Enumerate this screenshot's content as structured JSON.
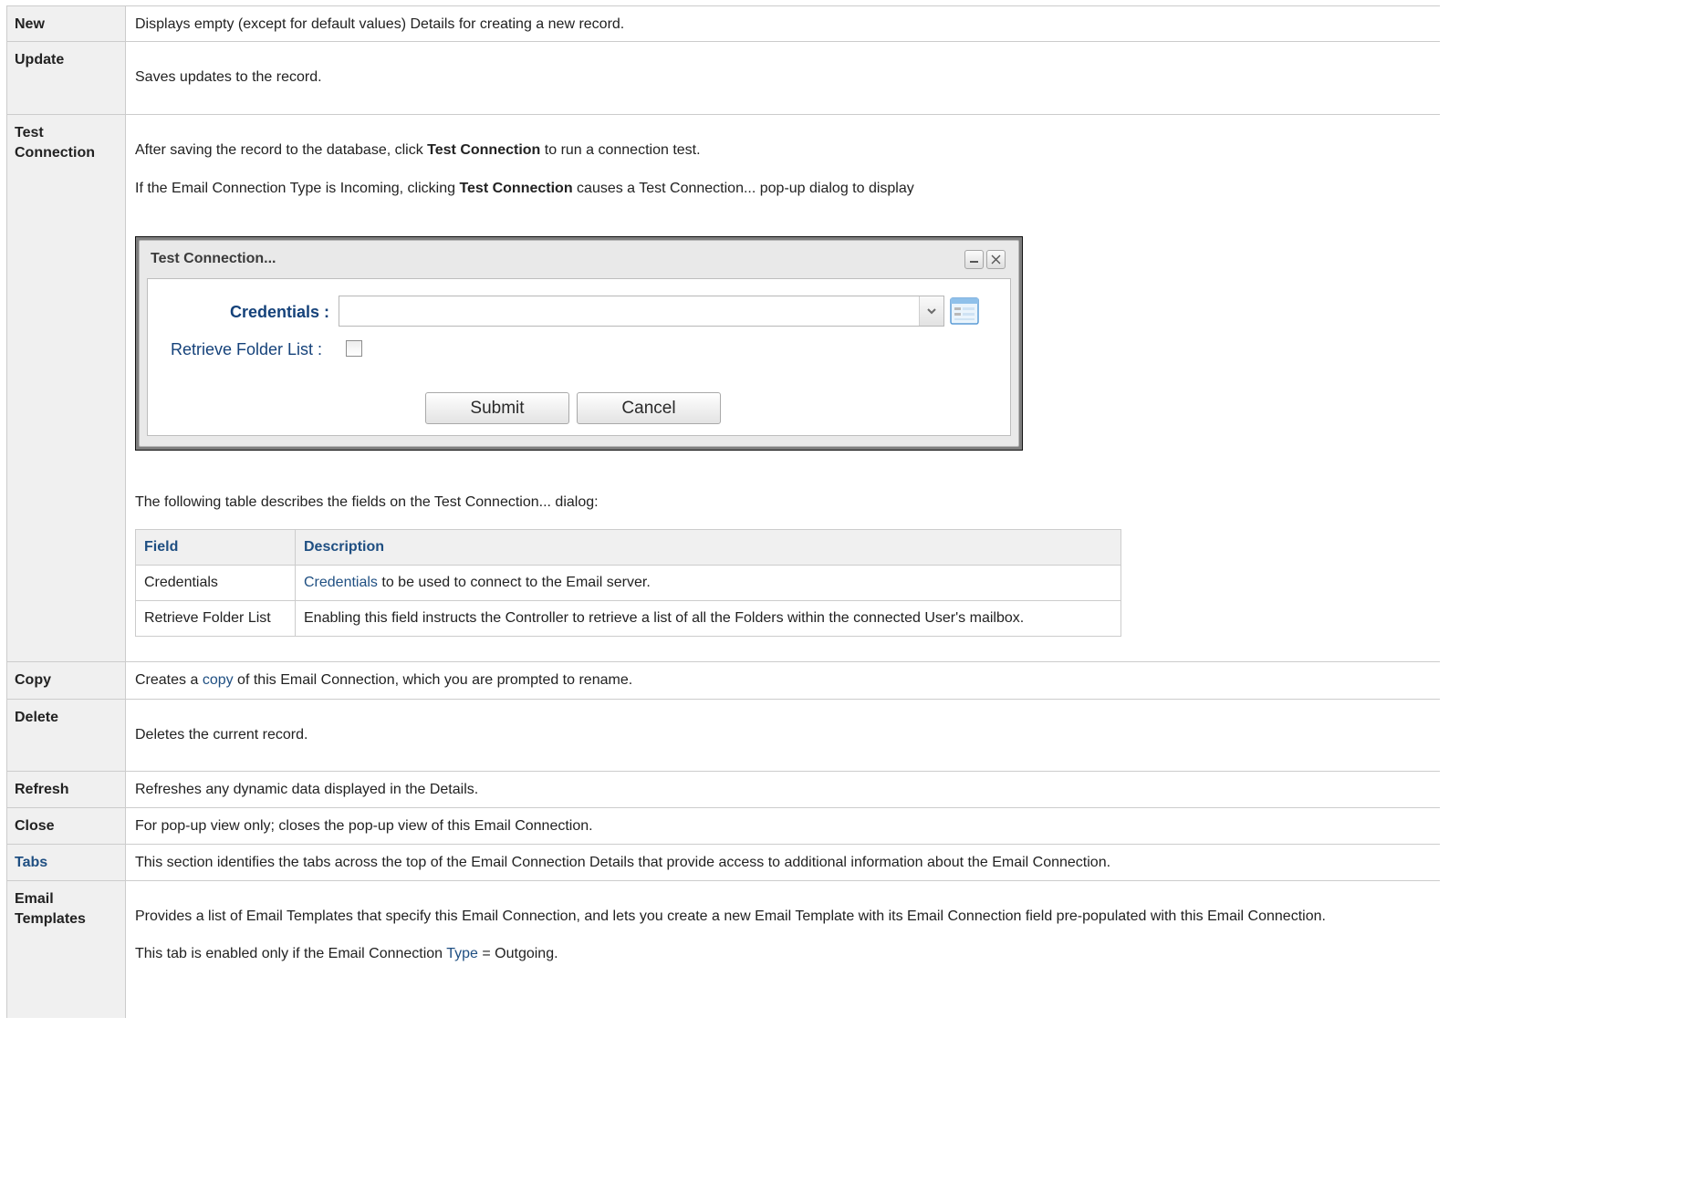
{
  "rows": {
    "new": {
      "label": "New",
      "desc": "Displays empty (except for default values) Details for creating a new record."
    },
    "update": {
      "label": "Update",
      "desc": "Saves updates to the record."
    },
    "test_connection": {
      "label": "Test Connection",
      "p1_pre": "After saving the record to the database, click ",
      "p1_bold": "Test Connection",
      "p1_post": " to run a connection test.",
      "p2_pre": "If the Email Connection Type is Incoming, clicking ",
      "p2_bold": "Test Connection",
      "p2_post": " causes a Test Connection... pop-up dialog to display",
      "dialog": {
        "title": "Test Connection...",
        "credentials_label": "Credentials :",
        "credentials_value": "",
        "retrieve_label": "Retrieve Folder List :",
        "retrieve_checked": false,
        "submit_label": "Submit",
        "cancel_label": "Cancel",
        "tool_icons": [
          "minimize-icon",
          "close-icon"
        ]
      },
      "p3": "The following table describes the fields on the Test Connection... dialog:",
      "fields_table": {
        "headers": [
          "Field",
          "Description"
        ],
        "rows": [
          {
            "field": "Credentials",
            "desc_link": "Credentials",
            "desc_rest": " to be used to connect to the Email server."
          },
          {
            "field": "Retrieve Folder List",
            "desc_link": "",
            "desc_rest": "Enabling this field instructs the Controller to retrieve a list of all the Folders within the connected User's mailbox."
          }
        ]
      }
    },
    "copy": {
      "label": "Copy",
      "pre": "Creates a ",
      "link": "copy",
      "post": " of this Email Connection, which you are prompted to rename."
    },
    "delete": {
      "label": "Delete",
      "desc": "Deletes the current record."
    },
    "refresh": {
      "label": "Refresh",
      "desc": "Refreshes any dynamic data displayed in the Details."
    },
    "close": {
      "label": "Close",
      "desc": "For pop-up view only; closes the pop-up view of this Email Connection."
    },
    "tabs": {
      "label": "Tabs",
      "desc": "This section identifies the tabs across the top of the Email Connection Details that provide access to additional information about the Email Connection."
    },
    "email_templates": {
      "label": "Email Templates",
      "p1": "Provides a list of Email Templates that specify this Email Connection, and lets you create a new Email Template with its Email Connection field pre-populated with this Email Connection.",
      "p2_pre": "This tab is enabled only if the Email Connection ",
      "p2_link": "Type",
      "p2_post": " = Outgoing."
    }
  },
  "colors": {
    "link": "#1f4f82",
    "header_bg": "#f0f0f0",
    "border": "#cccccc"
  }
}
